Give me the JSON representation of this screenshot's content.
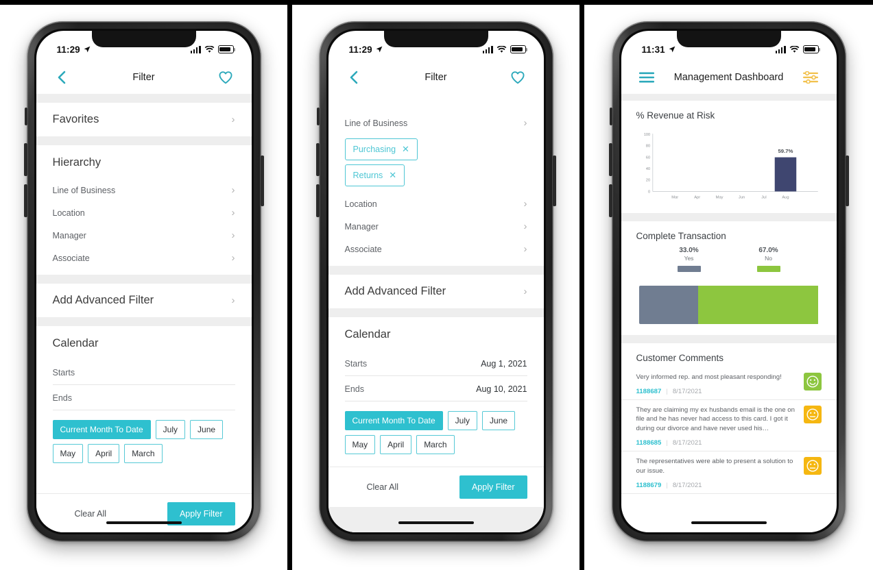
{
  "theme": {
    "accent": "#2ec0cf",
    "chip_border": "#4ec6d4",
    "bar_navy": "#3f4670",
    "bar_gray": "#707d91",
    "bar_green": "#8dc63f",
    "face_green": "#8dc63f",
    "face_amber": "#f5b711",
    "yellow": "#f2c14e"
  },
  "panels": [
    {
      "id": "filter-collapsed",
      "status": {
        "time": "11:29",
        "location_icon": "location-arrow-icon",
        "signal_icon": "cellular-signal-icon",
        "wifi_icon": "wifi-icon",
        "battery_icon": "battery-icon"
      },
      "header": {
        "back_icon": "chevron-left-icon",
        "title": "Filter",
        "favorite_icon": "heart-outline-icon"
      },
      "favorites": {
        "label": "Favorites",
        "chevron": "›"
      },
      "hierarchy": {
        "title": "Hierarchy",
        "items": [
          {
            "label": "Line of Business",
            "chevron": "›"
          },
          {
            "label": "Location",
            "chevron": "›"
          },
          {
            "label": "Manager",
            "chevron": "›"
          },
          {
            "label": "Associate",
            "chevron": "›"
          }
        ]
      },
      "advanced": {
        "label": "Add Advanced Filter",
        "chevron": "›"
      },
      "calendar": {
        "title": "Calendar",
        "starts_label": "Starts",
        "starts_value": "",
        "ends_label": "Ends",
        "ends_value": "",
        "months": [
          {
            "label": "Current Month To Date",
            "active": true
          },
          {
            "label": "July",
            "active": false
          },
          {
            "label": "June",
            "active": false
          },
          {
            "label": "May",
            "active": false
          },
          {
            "label": "April",
            "active": false
          },
          {
            "label": "March",
            "active": false
          }
        ]
      },
      "footer": {
        "clear_label": "Clear All",
        "apply_label": "Apply Filter"
      }
    },
    {
      "id": "filter-selected",
      "status": {
        "time": "11:29",
        "location_icon": "location-arrow-icon",
        "signal_icon": "cellular-signal-icon",
        "wifi_icon": "wifi-icon",
        "battery_icon": "battery-icon"
      },
      "header": {
        "back_icon": "chevron-left-icon",
        "title": "Filter",
        "favorite_icon": "heart-outline-icon"
      },
      "hierarchy": {
        "items": [
          {
            "label": "Line of Business",
            "chevron": "›"
          },
          {
            "label": "Location",
            "chevron": "›"
          },
          {
            "label": "Manager",
            "chevron": "›"
          },
          {
            "label": "Associate",
            "chevron": "›"
          }
        ],
        "selected_chips": [
          {
            "label": "Purchasing",
            "remove_icon": "close-icon"
          },
          {
            "label": "Returns",
            "remove_icon": "close-icon"
          }
        ]
      },
      "advanced": {
        "label": "Add Advanced Filter",
        "chevron": "›"
      },
      "calendar": {
        "title": "Calendar",
        "starts_label": "Starts",
        "starts_value": "Aug 1, 2021",
        "ends_label": "Ends",
        "ends_value": "Aug 10, 2021",
        "months": [
          {
            "label": "Current Month To Date",
            "active": true
          },
          {
            "label": "July",
            "active": false
          },
          {
            "label": "June",
            "active": false
          },
          {
            "label": "May",
            "active": false
          },
          {
            "label": "April",
            "active": false
          },
          {
            "label": "March",
            "active": false
          }
        ]
      },
      "footer": {
        "clear_label": "Clear All",
        "apply_label": "Apply Filter"
      }
    },
    {
      "id": "management-dashboard",
      "status": {
        "time": "11:31",
        "location_icon": "location-arrow-icon",
        "signal_icon": "cellular-signal-icon",
        "wifi_icon": "wifi-icon",
        "battery_icon": "battery-icon"
      },
      "header": {
        "menu_icon": "hamburger-menu-icon",
        "title": "Management  Dashboard",
        "filter_icon": "filter-sliders-icon"
      },
      "revenue_card": {
        "title": "% Revenue at Risk"
      },
      "transaction_card": {
        "title": "Complete Transaction"
      },
      "comments_card": {
        "title": "Customer Comments",
        "items": [
          {
            "text": "Very informed rep. and most pleasant responding!",
            "id": "1188687",
            "date": "8/17/2021",
            "sentiment": "positive",
            "face_icon": "smiley-happy-icon"
          },
          {
            "text": "They are claiming my ex husbands email is the one on file and he has never had access to this card. I got it during our divorce and have never used his…",
            "id": "1188685",
            "date": "8/17/2021",
            "sentiment": "neutral",
            "face_icon": "smiley-neutral-icon"
          },
          {
            "text": "The representatives were able to present a solution to our issue.",
            "id": "1188679",
            "date": "8/17/2021",
            "sentiment": "neutral",
            "face_icon": "smiley-neutral-icon"
          }
        ]
      }
    }
  ],
  "chart_data": [
    {
      "type": "bar",
      "title": "% Revenue at Risk",
      "categories": [
        "Mar",
        "Apr",
        "May",
        "Jun",
        "Jul",
        "Aug"
      ],
      "values": [
        0,
        0,
        0,
        0,
        0,
        59.7
      ],
      "data_labels": [
        "",
        "",
        "",
        "",
        "",
        "59.7%"
      ],
      "xlabel": "",
      "ylabel": "",
      "ylim": [
        0,
        100
      ],
      "yticks": [
        0,
        20,
        40,
        60,
        80,
        100
      ],
      "grid": false,
      "legend": "none",
      "bar_color": "#3f4670"
    },
    {
      "type": "bar",
      "title": "Complete Transaction",
      "orientation": "horizontal-stacked",
      "categories": [
        "Yes",
        "No"
      ],
      "values": [
        33.0,
        67.0
      ],
      "data_labels": [
        "33.0%",
        "67.0%"
      ],
      "colors": [
        "#707d91",
        "#8dc63f"
      ],
      "legend": "top",
      "xlabel": "",
      "ylabel": ""
    }
  ]
}
